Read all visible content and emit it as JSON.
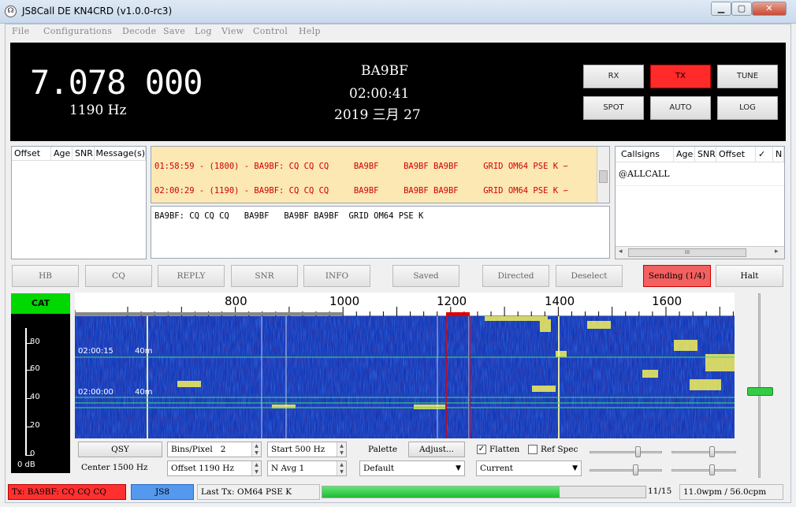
{
  "window": {
    "title": "JS8Call DE KN4CRD (v1.0.0-rc3)",
    "app_icon": "app-icon",
    "controls": [
      "minimize",
      "maximize",
      "close"
    ]
  },
  "menu": [
    "File",
    "Configurations",
    "Decode",
    "Save",
    "Log",
    "View",
    "Control",
    "Help"
  ],
  "display": {
    "frequency": "7.078 000",
    "offset": "1190 Hz",
    "callsign": "BA9BF",
    "time": "02:00:41",
    "date": "2019 三月 27"
  },
  "control_buttons": [
    {
      "label": "RX",
      "active": false
    },
    {
      "label": "TX",
      "active": true
    },
    {
      "label": "TUNE",
      "active": false
    },
    {
      "label": "SPOT",
      "active": false
    },
    {
      "label": "AUTO",
      "active": false
    },
    {
      "label": "LOG",
      "active": false
    }
  ],
  "band_activity": {
    "columns": [
      "Offset",
      "Age",
      "SNR",
      "Message(s)"
    ]
  },
  "rx_text": [
    "01:58:59 - (1800) - BA9BF: CQ CQ CQ     BA9BF     BA9BF BA9BF     GRID OM64 PSE K ∽",
    "02:00:29 - (1190) - BA9BF: CQ CQ CQ     BA9BF     BA9BF BA9BF     GRID OM64 PSE K ∽"
  ],
  "compose_text": "BA9BF: CQ CQ CQ   BA9BF   BA9BF BA9BF  GRID OM64 PSE K",
  "callsigns": {
    "columns": [
      "Callsigns",
      "Age",
      "SNR",
      "Offset",
      "✓",
      "N"
    ],
    "rows": [
      "@ALLCALL"
    ]
  },
  "op_buttons": [
    "HB",
    "CQ",
    "REPLY",
    "SNR",
    "INFO",
    "Saved",
    "Directed",
    "Deselect"
  ],
  "sending": "Sending (1/4)",
  "halt": "Halt",
  "cat": "CAT",
  "meter": {
    "labels": [
      "80",
      "60",
      "40",
      "20",
      "0"
    ],
    "unit": "0 dB"
  },
  "ruler": {
    "labels": [
      "800",
      "1000",
      "1200",
      "1400",
      "1600"
    ]
  },
  "waterfall": {
    "timestamps": [
      "02:00:15",
      "02:00:00"
    ],
    "marks": [
      "40m",
      "40m"
    ]
  },
  "controls": {
    "qsy": "QSY",
    "bins_label": "Bins/Pixel",
    "bins_value": "2",
    "start": "Start 500 Hz",
    "palette_label": "Palette",
    "adjust": "Adjust...",
    "flatten": "Flatten",
    "flatten_checked": true,
    "ref_spec": "Ref Spec",
    "ref_spec_checked": false,
    "center": "Center 1500 Hz",
    "offset": "Offset 1190 Hz",
    "navg": "N Avg 1",
    "palette_value": "Default",
    "spec_value": "Current"
  },
  "status": {
    "tx": "Tx: BA9BF: CQ CQ CQ",
    "mode": "JS8",
    "last_tx": "Last Tx: OM64 PSE K",
    "progress_label": "11/15",
    "progress_fraction": 0.733,
    "wpm": "11.0wpm / 56.0cpm"
  },
  "colors": {
    "tx_red": "#ff2a2a",
    "cat_green": "#00d800",
    "rx_bg": "#fbe8b3",
    "waterfall_bg": "#1238b8",
    "status_tx": "#ff3030",
    "status_mode": "#5599ee",
    "progress": "#2ecc40"
  }
}
